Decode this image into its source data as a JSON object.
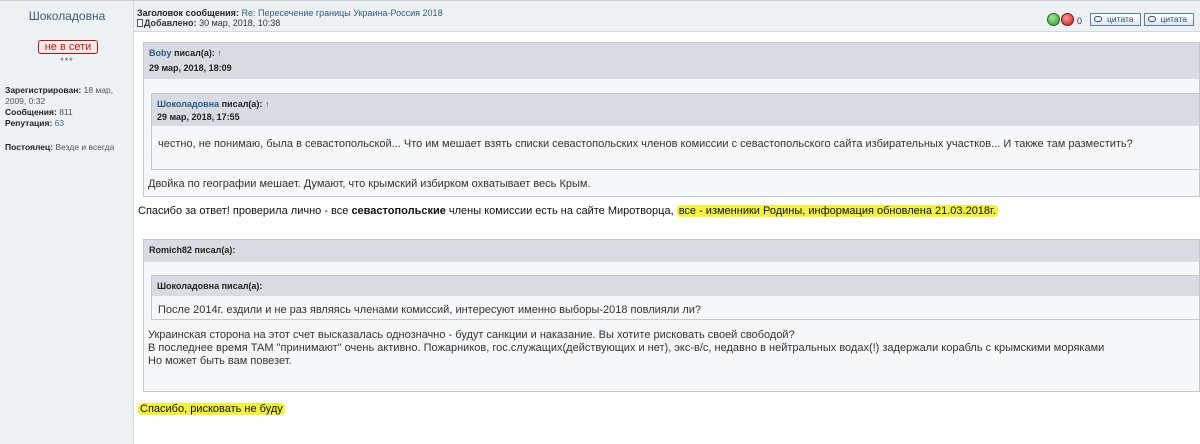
{
  "author": {
    "name": "Шоколадовна",
    "status": "не в сети",
    "stars": "***",
    "registered_label": "Зарегистрирован:",
    "registered_value": "18 мар, 2009, 0:32",
    "messages_label": "Сообщения:",
    "messages_value": "811",
    "reputation_label": "Репутация:",
    "reputation_value": "63",
    "resident_label": "Постоялец:",
    "resident_value": "Везде и всегда"
  },
  "header": {
    "subject_label": "Заголовок сообщения:",
    "subject_prefix": "Re: ",
    "subject_value": "Пересечение границы Украина-Россия 2018",
    "added_label": "Добавлено:",
    "added_value": "30 мар, 2018, 10:38",
    "vote_count": "0",
    "quote_label_1": "цитата",
    "quote_label_2": "цитата"
  },
  "quote1": {
    "author": "Boby",
    "said": "писал(а):",
    "arrow": "↑",
    "date": "29 мар, 2018, 18:09",
    "nested": {
      "author": "Шоколадовна",
      "said": "писал(а):",
      "arrow": "↑",
      "date": "29 мар, 2018, 17:55",
      "text": "честно, не понимаю, была в севастопольской... Что им мешает взять списки севастопольских членов комиссии с севастопольского сайта избирательных участков... И также там разместить?"
    },
    "text": "Двойка по географии мешает. Думают, что крымский избирком охватывает весь Крым."
  },
  "reply1": {
    "part1": "Спасибо за ответ! проверила лично - все ",
    "bold": "севастопольские",
    "part2": " члены комиссии есть на сайте Миротворца, ",
    "highlight": "все - изменники Родины, информация обновлена 21.03.2018г."
  },
  "quote2": {
    "author_said": "Romich82 писал(а):",
    "nested": {
      "author_said": "Шоколадовна писал(а):",
      "text": "После 2014г. ездили и не раз являясь членами комиссий, интересуют именно выборы-2018 повлияли ли?"
    },
    "lines": [
      "Украинская сторона на этот счет высказалась однозначно - будут санкции и наказание. Вы хотите рисковать своей свободой?",
      "В последнее время ТАМ \"принимают\" очень активно. Пожарников, гос.служащих(действующих и нет), экс-в/с, недавно в нейтральных водах(!) задержали корабль с крымскими моряками",
      "Но может быть вам повезет."
    ]
  },
  "reply2": {
    "highlight": "Спасибо, рисковать не буду"
  },
  "colors": {
    "highlight": "#f2f23a",
    "link": "#2d5c88",
    "status": "#c01818",
    "quote_head_bg": "#d8dce2"
  }
}
